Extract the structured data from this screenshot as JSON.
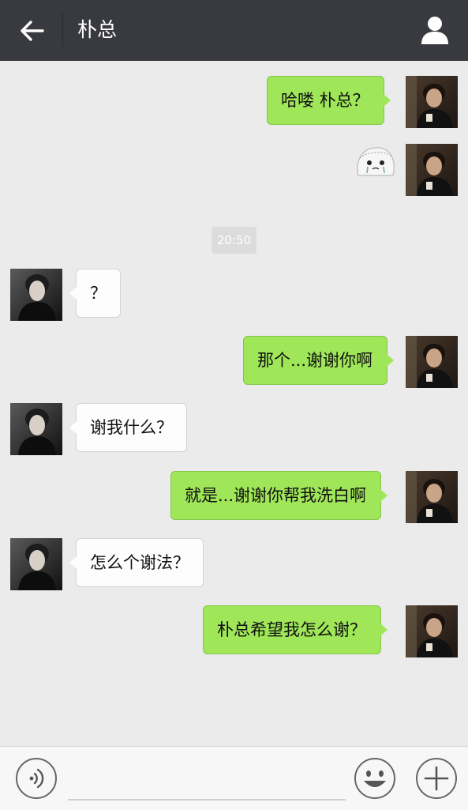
{
  "header": {
    "title": "朴总",
    "back_icon": "arrow-left-icon",
    "profile_icon": "person-icon"
  },
  "timestamp": "20:50",
  "messages": [
    {
      "side": "sent",
      "text": "哈喽  朴总？"
    },
    {
      "side": "sent",
      "sticker": "crying-face-sticker"
    },
    {
      "side": "recv",
      "text": "？"
    },
    {
      "side": "sent",
      "text": "那个...谢谢你啊"
    },
    {
      "side": "recv",
      "text": "谢我什么？"
    },
    {
      "side": "sent",
      "text": "就是...谢谢你帮我洗白啊"
    },
    {
      "side": "recv",
      "text": "怎么个谢法？"
    },
    {
      "side": "sent",
      "text": "朴总希望我怎么谢？"
    }
  ],
  "composer": {
    "voice_icon": "voice-icon",
    "emoji_icon": "emoji-icon",
    "plus_icon": "plus-icon",
    "input_value": ""
  },
  "colors": {
    "header_bg": "#393a3f",
    "chat_bg": "#ebebeb",
    "sent_bubble": "#9fe658",
    "recv_bubble": "#fdfdfd"
  }
}
